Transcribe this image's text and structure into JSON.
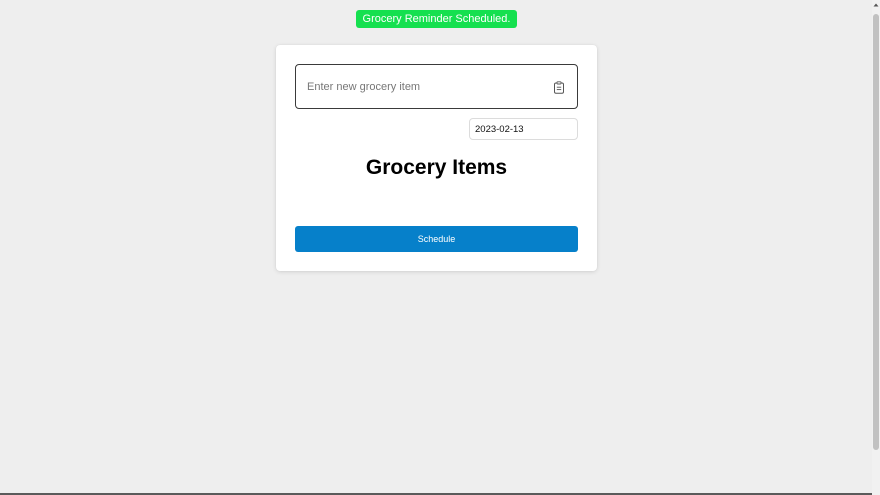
{
  "toast": {
    "message": "Grocery Reminder Scheduled.",
    "color": "#15e04f"
  },
  "form": {
    "item_input": {
      "value": "",
      "placeholder": "Enter new grocery item",
      "icon": "clipboard-icon"
    },
    "date_input": {
      "value": "2023-02-13"
    },
    "heading": "Grocery Items",
    "schedule_label": "Schedule",
    "button_color": "#0680ca"
  }
}
